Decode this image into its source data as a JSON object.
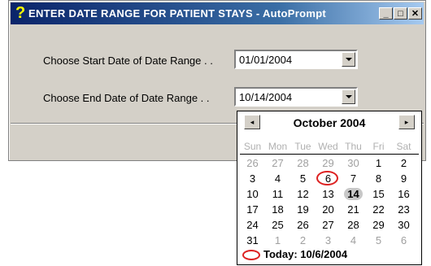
{
  "window": {
    "title": "ENTER DATE RANGE  FOR PATIENT STAYS - AutoPrompt",
    "title_icon": "?",
    "minimize_label": "_",
    "maximize_label": "□",
    "close_label": "✕"
  },
  "start_date": {
    "label": "Choose Start Date of Date Range  . .",
    "value": "01/01/2004"
  },
  "end_date": {
    "label": "Choose End Date of  Date Range  . .",
    "value": "10/14/2004"
  },
  "calendar": {
    "month_title": "October 2004",
    "prev_label": "◂",
    "next_label": "▸",
    "weekdays": [
      "Sun",
      "Mon",
      "Tue",
      "Wed",
      "Thu",
      "Fri",
      "Sat"
    ],
    "weeks": [
      [
        {
          "d": "26",
          "other": true
        },
        {
          "d": "27",
          "other": true
        },
        {
          "d": "28",
          "other": true
        },
        {
          "d": "29",
          "other": true
        },
        {
          "d": "30",
          "other": true
        },
        {
          "d": "1"
        },
        {
          "d": "2"
        }
      ],
      [
        {
          "d": "3"
        },
        {
          "d": "4"
        },
        {
          "d": "5"
        },
        {
          "d": "6",
          "today": true
        },
        {
          "d": "7"
        },
        {
          "d": "8"
        },
        {
          "d": "9"
        }
      ],
      [
        {
          "d": "10"
        },
        {
          "d": "11"
        },
        {
          "d": "12"
        },
        {
          "d": "13"
        },
        {
          "d": "14",
          "selected": true
        },
        {
          "d": "15"
        },
        {
          "d": "16"
        }
      ],
      [
        {
          "d": "17"
        },
        {
          "d": "18"
        },
        {
          "d": "19"
        },
        {
          "d": "20"
        },
        {
          "d": "21"
        },
        {
          "d": "22"
        },
        {
          "d": "23"
        }
      ],
      [
        {
          "d": "24"
        },
        {
          "d": "25"
        },
        {
          "d": "26"
        },
        {
          "d": "27"
        },
        {
          "d": "28"
        },
        {
          "d": "29"
        },
        {
          "d": "30"
        }
      ],
      [
        {
          "d": "31"
        },
        {
          "d": "1",
          "other": true
        },
        {
          "d": "2",
          "other": true
        },
        {
          "d": "3",
          "other": true
        },
        {
          "d": "4",
          "other": true
        },
        {
          "d": "5",
          "other": true
        },
        {
          "d": "6",
          "other": true
        }
      ]
    ],
    "today_label": "Today: 10/6/2004"
  },
  "colors": {
    "title_start": "#0a246a",
    "title_end": "#a6caf0",
    "dialog_face": "#d4d0c8",
    "today_circle": "#dd2222"
  }
}
